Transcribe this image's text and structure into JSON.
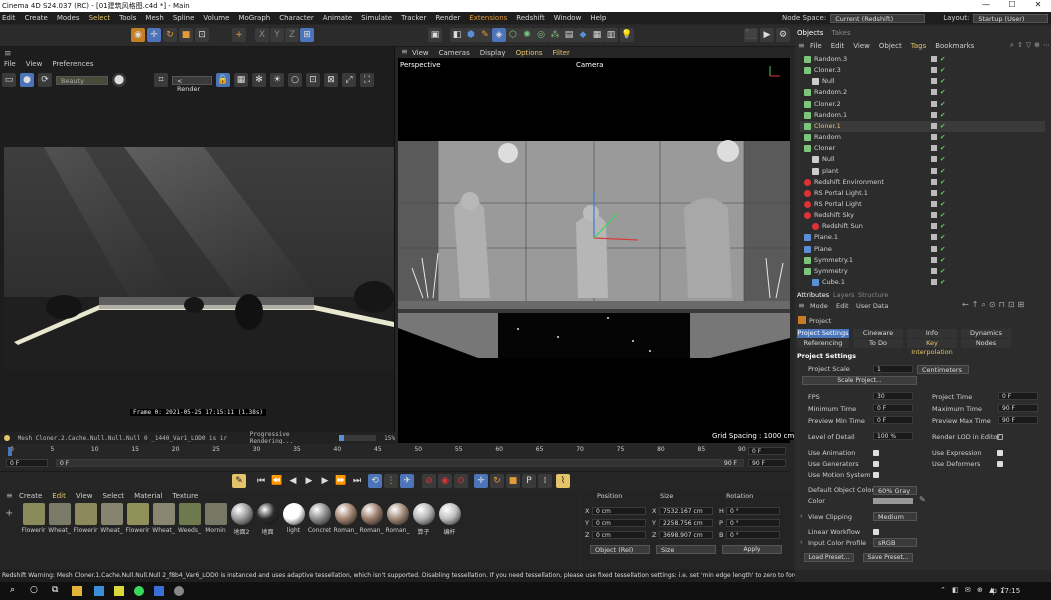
{
  "window": {
    "title": "Cinema 4D S24.037 (RC) - [01建筑风格图.c4d *] - Main",
    "controls": [
      "—",
      "☐",
      "✕"
    ]
  },
  "menubar": {
    "items": [
      "Edit",
      "Create",
      "Modes",
      "Select",
      "Tools",
      "Mesh",
      "Spline",
      "Volume",
      "MoGraph",
      "Character",
      "Animate",
      "Simulate",
      "Tracker",
      "Render",
      "Extensions",
      "Redshift",
      "Window",
      "Help"
    ],
    "node_space_label": "Node Space:",
    "node_space_value": "Current (Redshift)",
    "layout_label": "Layout:",
    "layout_value": "Startup (User)"
  },
  "render_view": {
    "menu": [
      "File",
      "View",
      "Preferences"
    ],
    "aov_select": "Beauty",
    "render_select": "< Render",
    "frame_info": "Frame  0:  2021-05-25  17:15:11  (1.38s)",
    "bottom_status": "Mesh Cloner.2.Cache.Null.Null.Null 0 _1440_Var1_LOD0 is ir",
    "progress_label": "Progressive Rendering...",
    "progress_value": "15%",
    "progress_fraction": 0.15
  },
  "viewport": {
    "menu": [
      "View",
      "Cameras",
      "Display",
      "Options",
      "Filter"
    ],
    "label": "Perspective",
    "camera_label": "Camera",
    "grid_spacing": "Grid Spacing : 1000 cm"
  },
  "timeline": {
    "ticks": [
      "0",
      "5",
      "10",
      "15",
      "20",
      "25",
      "30",
      "35",
      "40",
      "45",
      "50",
      "55",
      "60",
      "65",
      "70",
      "75",
      "80",
      "85",
      "90"
    ],
    "current_end": "0 F",
    "start_frame": "0 F",
    "min_frame": "0 F",
    "max_frame": "90 F",
    "end_frame": "90 F"
  },
  "materials": {
    "menu": [
      "Create",
      "Edit",
      "View",
      "Select",
      "Material",
      "Texture"
    ],
    "items": [
      {
        "name": "Flowerir",
        "color": "#8a8a5a"
      },
      {
        "name": "Wheat_",
        "color": "#7a7a68"
      },
      {
        "name": "Flowerir",
        "color": "#8c8a5c"
      },
      {
        "name": "Wheat_",
        "color": "#86846e"
      },
      {
        "name": "Flowerir",
        "color": "#90905a"
      },
      {
        "name": "Wheat_",
        "color": "#888670"
      },
      {
        "name": "Weeds_",
        "color": "#6e7a4e"
      },
      {
        "name": "Mornin",
        "color": "#777766"
      },
      {
        "name": "地面2",
        "color": "#9a9a9a"
      },
      {
        "name": "地面",
        "color": "#2a2a2a"
      },
      {
        "name": "light",
        "color": "#ffffff"
      },
      {
        "name": "Concret",
        "color": "#8e8e8e"
      },
      {
        "name": "Roman_",
        "color": "#a28470"
      },
      {
        "name": "Roman_",
        "color": "#9a7c6a"
      },
      {
        "name": "Roman_",
        "color": "#a08a78"
      },
      {
        "name": "算子",
        "color": "#b4b4b4"
      },
      {
        "name": "编杆",
        "color": "#c0c0c0"
      }
    ]
  },
  "coordinates": {
    "headers": [
      "Position",
      "Size",
      "Rotation"
    ],
    "rows": [
      {
        "axis": "X",
        "pos": "0 cm",
        "saxis": "X",
        "size": "7532.167 cm",
        "raxis": "H",
        "rot": "0 °"
      },
      {
        "axis": "Y",
        "pos": "0 cm",
        "saxis": "Y",
        "size": "2258.756 cm",
        "raxis": "P",
        "rot": "0 °"
      },
      {
        "axis": "Z",
        "pos": "0 cm",
        "saxis": "Z",
        "size": "3698.907 cm",
        "raxis": "B",
        "rot": "0 °"
      }
    ],
    "mode_select": "Object (Rel)",
    "size_select": "Size",
    "apply": "Apply"
  },
  "status_bar": "Redshift Warning: Mesh Cloner.1.Cache.Null.Null.Null 2_f8b4_Var6_LOD0 is instanced and uses adaptive tessellation, which isn't supported. Disabling tessellation. If you need tessellation, please use fixed tessellation settings: i.e. set 'min edge length' to zero to force a ma",
  "objects": {
    "tabs": [
      "Objects",
      "Takes"
    ],
    "menu": [
      "File",
      "Edit",
      "View",
      "Object",
      "Tags",
      "Bookmarks"
    ],
    "items": [
      {
        "name": "Random.3",
        "indent": 0,
        "color": "#7bc67b",
        "hl": false
      },
      {
        "name": "Cloner.3",
        "indent": 0,
        "color": "#7bc67b",
        "hl": false
      },
      {
        "name": "Null",
        "indent": 1,
        "color": "#cccccc",
        "hl": false
      },
      {
        "name": "Random.2",
        "indent": 0,
        "color": "#7bc67b",
        "hl": false
      },
      {
        "name": "Cloner.2",
        "indent": 0,
        "color": "#7bc67b",
        "hl": false
      },
      {
        "name": "Random.1",
        "indent": 0,
        "color": "#7bc67b",
        "hl": false
      },
      {
        "name": "Cloner.1",
        "indent": 0,
        "color": "#7bc67b",
        "hl": true
      },
      {
        "name": "Random",
        "indent": 0,
        "color": "#7bc67b",
        "hl": false
      },
      {
        "name": "Cloner",
        "indent": 0,
        "color": "#7bc67b",
        "hl": false
      },
      {
        "name": "Null",
        "indent": 1,
        "color": "#cccccc",
        "hl": false
      },
      {
        "name": "plant",
        "indent": 1,
        "color": "#cccccc",
        "hl": false
      },
      {
        "name": "Redshift Environment",
        "indent": 0,
        "color": "#d33",
        "hl": false
      },
      {
        "name": "RS Portal Light.1",
        "indent": 0,
        "color": "#d33",
        "hl": false
      },
      {
        "name": "RS Portal Light",
        "indent": 0,
        "color": "#d33",
        "hl": false
      },
      {
        "name": "Redshift Sky",
        "indent": 0,
        "color": "#d33",
        "hl": false
      },
      {
        "name": "Redshift Sun",
        "indent": 1,
        "color": "#d33",
        "hl": false
      },
      {
        "name": "Plane.1",
        "indent": 0,
        "color": "#5a8fd8",
        "hl": false
      },
      {
        "name": "Plane",
        "indent": 0,
        "color": "#5a8fd8",
        "hl": false
      },
      {
        "name": "Symmetry.1",
        "indent": 0,
        "color": "#7bc67b",
        "hl": false
      },
      {
        "name": "Symmetry",
        "indent": 0,
        "color": "#7bc67b",
        "hl": false
      },
      {
        "name": "Cube.1",
        "indent": 1,
        "color": "#5a8fd8",
        "hl": false
      }
    ]
  },
  "attributes": {
    "tabs": [
      "Attributes",
      "Layers",
      "Structure"
    ],
    "menu": [
      "Mode",
      "Edit",
      "User Data"
    ],
    "object": "Project",
    "subtabs_row1": [
      "Project Settings",
      "Cineware",
      "Info",
      "Dynamics"
    ],
    "subtabs_row2": [
      "Referencing",
      "To Do",
      "Key Interpolation",
      "Nodes"
    ],
    "section": "Project Settings",
    "project_scale_label": "Project Scale",
    "project_scale_value": "1",
    "project_scale_unit": "Centimeters",
    "scale_project_btn": "Scale Project...",
    "fps_label": "FPS",
    "fps_value": "30",
    "project_time_label": "Project Time",
    "project_time_value": "0 F",
    "min_time_label": "Minimum Time",
    "min_time_value": "0 F",
    "max_time_label": "Maximum Time",
    "max_time_value": "90 F",
    "prev_min_label": "Preview Min Time",
    "prev_min_value": "0 F",
    "prev_max_label": "Preview Max Time",
    "prev_max_value": "90 F",
    "lod_label": "Level of Detail",
    "lod_value": "100 %",
    "render_lod_label": "Render LOD in Editor",
    "use_anim": "Use Animation",
    "use_expr": "Use Expression",
    "use_gen": "Use Generators",
    "use_def": "Use Deformers",
    "use_motion": "Use Motion System",
    "def_color_label": "Default Object Color",
    "def_color_value": "60% Gray",
    "color_label": "Color",
    "view_clipping_label": "View Clipping",
    "view_clipping_value": "Medium",
    "linear_wf_label": "Linear Workflow",
    "input_cp_label": "Input Color Profile",
    "input_cp_value": "sRGB",
    "load_preset": "Load Preset...",
    "save_preset": "Save Preset..."
  },
  "taskbar": {
    "time": "17:15",
    "lang": "中"
  }
}
